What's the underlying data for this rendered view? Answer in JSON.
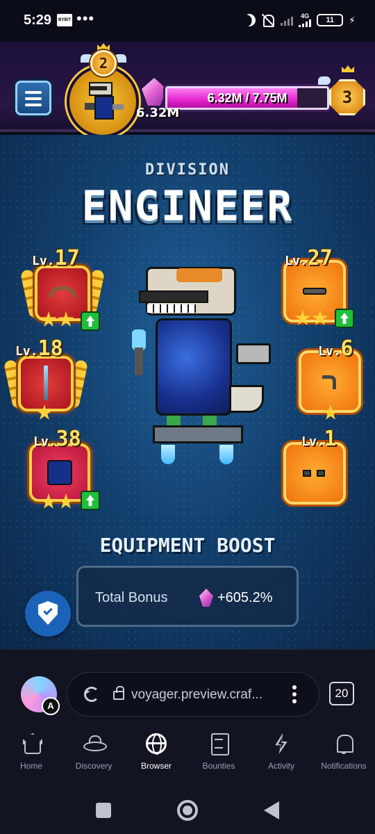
{
  "status_bar": {
    "time": "5:29",
    "app_icon_text": "BYBIT",
    "dots": "•••",
    "network": "4G",
    "battery": "11"
  },
  "header": {
    "player_level": "2",
    "next_level": "3",
    "xp_amount": "6.32M",
    "xp_progress_text": "6.32M / 7.75M",
    "xp_progress": 0.815
  },
  "division": {
    "label": "DIVISION",
    "name": "ENGINEER"
  },
  "equipment": {
    "left": [
      {
        "lv_prefix": "Lv.",
        "level": "17",
        "stars": 2,
        "upgrade": true
      },
      {
        "lv_prefix": "Lv.",
        "level": "18",
        "stars": 1,
        "upgrade": false
      },
      {
        "lv_prefix": "Lv.",
        "level": "38",
        "stars": 2,
        "upgrade": true
      }
    ],
    "right": [
      {
        "lv_prefix": "Lv.",
        "level": "27",
        "stars": 2,
        "upgrade": true
      },
      {
        "lv_prefix": "Lv.",
        "level": "6",
        "stars": 1,
        "upgrade": false
      },
      {
        "lv_prefix": "Lv.",
        "level": "1",
        "stars": 0,
        "upgrade": false
      }
    ]
  },
  "boost": {
    "title": "EQUIPMENT BOOST",
    "total_label": "Total Bonus",
    "total_value": "+605.2%"
  },
  "browser": {
    "url": "voyager.preview.craf...",
    "tab_count": "20",
    "wallet_badge": "A"
  },
  "nav": {
    "items": [
      {
        "label": "Home",
        "icon": "home-icon"
      },
      {
        "label": "Discovery",
        "icon": "ufo-icon"
      },
      {
        "label": "Browser",
        "icon": "globe-icon"
      },
      {
        "label": "Bounties",
        "icon": "scroll-icon"
      },
      {
        "label": "Activity",
        "icon": "bolt-icon"
      },
      {
        "label": "Notifications",
        "icon": "bell-icon"
      }
    ]
  },
  "colors": {
    "xp_fill": "#e326cc",
    "accent_blue": "#1b63b8",
    "gold": "#ffd23a"
  }
}
